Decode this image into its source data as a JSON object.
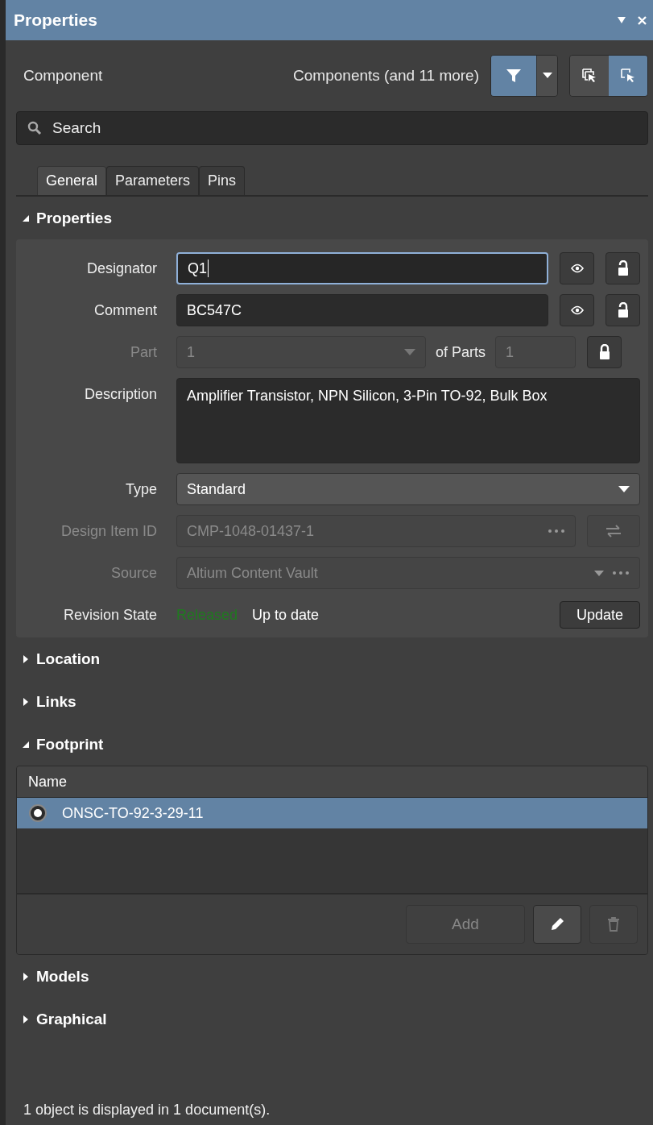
{
  "window": {
    "title": "Properties"
  },
  "toolbar": {
    "object_type": "Component",
    "scope": "Components (and 11 more)",
    "filter_on": true,
    "select_modes": [
      {
        "selected": false
      },
      {
        "selected": true
      }
    ]
  },
  "search": {
    "placeholder": "Search"
  },
  "tabs": [
    {
      "label": "General",
      "selected": true
    },
    {
      "label": "Parameters",
      "selected": false
    },
    {
      "label": "Pins",
      "selected": false
    }
  ],
  "sections": [
    {
      "kind": "properties",
      "title": "Properties",
      "expanded": true,
      "fields": [
        {
          "kind": "text",
          "label": "Designator",
          "value": "Q1",
          "focused": true,
          "visible": true,
          "locked": false
        },
        {
          "kind": "text",
          "label": "Comment",
          "value": "BC547C",
          "focused": false,
          "visible": true,
          "locked": false
        },
        {
          "kind": "part",
          "label": "Part",
          "value": "1",
          "of_label": "of Parts",
          "of_value": "1",
          "disabled": true,
          "locked": true
        },
        {
          "kind": "textarea",
          "label": "Description",
          "value": "Amplifier Transistor, NPN Silicon, 3-Pin TO-92, Bulk Box"
        },
        {
          "kind": "select",
          "label": "Type",
          "value": "Standard",
          "disabled": false
        },
        {
          "kind": "item-id",
          "label": "Design Item ID",
          "value": "CMP-1048-01437-1",
          "disabled": true
        },
        {
          "kind": "source",
          "label": "Source",
          "value": "Altium Content Vault",
          "disabled": true
        },
        {
          "kind": "revision",
          "label": "Revision State",
          "state": "Released",
          "status": "Up to date",
          "button": "Update"
        }
      ]
    },
    {
      "kind": "plain",
      "title": "Location",
      "expanded": false
    },
    {
      "kind": "plain",
      "title": "Links",
      "expanded": false
    },
    {
      "kind": "footprint",
      "title": "Footprint",
      "expanded": true,
      "columns": [
        "Name"
      ],
      "rows": [
        {
          "name": "ONSC-TO-92-3-29-11",
          "selected": true,
          "current": true
        }
      ],
      "add": {
        "label": "Add",
        "disabled": true
      },
      "edit": {
        "disabled": false
      },
      "delete": {
        "disabled": true
      }
    },
    {
      "kind": "plain",
      "title": "Models",
      "expanded": false
    },
    {
      "kind": "plain",
      "title": "Graphical",
      "expanded": false
    }
  ],
  "status": "1 object is displayed in 1 document(s)."
}
